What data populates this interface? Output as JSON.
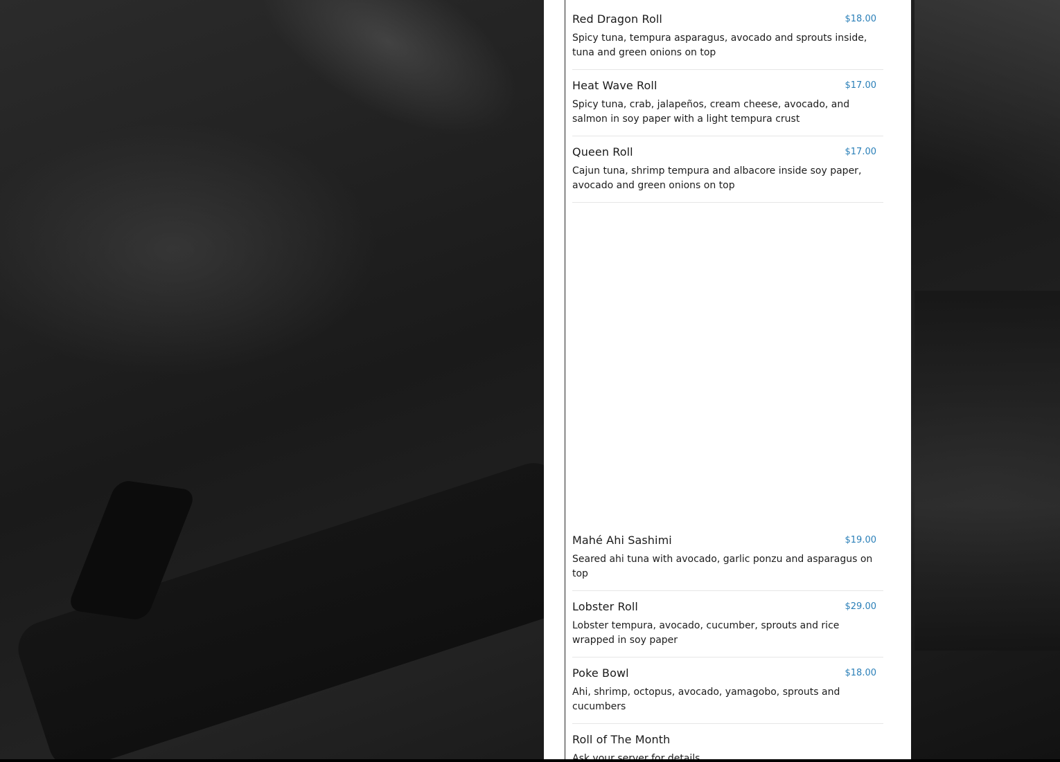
{
  "menu": {
    "items_top": [
      {
        "name": "Red Dragon Roll",
        "price": "$18.00",
        "description": "Spicy tuna, tempura asparagus, avocado and sprouts inside, tuna and green onions on top"
      },
      {
        "name": "Heat Wave Roll",
        "price": "$17.00",
        "description": "Spicy tuna, crab, jalapeños, cream cheese, avocado, and salmon in soy paper with a light tempura crust"
      },
      {
        "name": "Queen Roll",
        "price": "$17.00",
        "description": "Cajun tuna, shrimp tempura and albacore inside soy paper, avocado and green onions on top"
      }
    ],
    "items_bottom": [
      {
        "name": "Mahé Ahi Sashimi",
        "price": "$19.00",
        "description": "Seared ahi tuna with avocado, garlic ponzu and asparagus on top"
      },
      {
        "name": "Lobster Roll",
        "price": "$29.00",
        "description": "Lobster tempura, avocado, cucumber, sprouts and rice wrapped in soy paper"
      },
      {
        "name": "Poke Bowl",
        "price": "$18.00",
        "description": "Ahi, shrimp, octopus, avocado, yamagobo, sprouts and cucumbers"
      },
      {
        "name": "Roll of The Month",
        "price": "",
        "description": "Ask your server for details"
      }
    ]
  },
  "colors": {
    "price": "#2a7fb8",
    "panel_background": "#ffffff",
    "page_background": "#1e1e1e"
  }
}
